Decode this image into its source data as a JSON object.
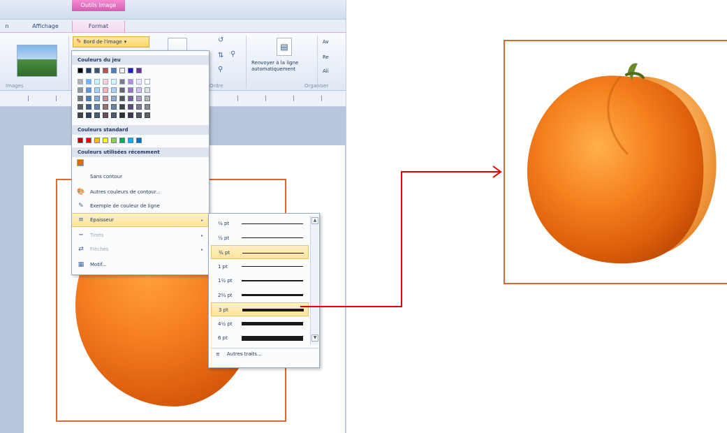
{
  "ribbon": {
    "context_group": "Outils Image",
    "tabs": [
      "Affichage",
      "Format"
    ],
    "border_button": "Bord de l'image",
    "wrap_label": "Renvoyer à la ligne automatiquement",
    "group_labels": [
      "Images",
      "Ordre",
      "Organiser"
    ],
    "organize_items": [
      "Av",
      "Re",
      "Ali"
    ]
  },
  "dropdown": {
    "theme_colors_heading": "Couleurs du jeu",
    "theme_colors": [
      "#000000",
      "#1f3864",
      "#44546a",
      "#c0504d",
      "#4f81bd",
      "#f2f2f2",
      "#1f1fbf",
      "#7030a0"
    ],
    "shade_columns": [
      "#7f7f7f",
      "#4f81bd",
      "#8db3e2",
      "#d99694",
      "#95b3d7",
      "#595959",
      "#8064a2",
      "#b2a1c7",
      "#bfbfbf"
    ],
    "standard_colors_heading": "Couleurs standard",
    "standard_colors": [
      "#c00000",
      "#ff0000",
      "#ffc000",
      "#ffff00",
      "#92d050",
      "#00b050",
      "#00b0f0",
      "#0070c0"
    ],
    "recent_colors_heading": "Couleurs utilisées récemment",
    "recent_colors": [
      "#e46c0a"
    ],
    "items": [
      {
        "label": "Sans contour"
      },
      {
        "label": "Autres couleurs de contour..."
      },
      {
        "label": "Exemple de couleur de ligne"
      },
      {
        "label": "Épaisseur"
      },
      {
        "label": "Tirets"
      },
      {
        "label": "Flèches"
      },
      {
        "label": "Motif..."
      }
    ]
  },
  "weight_submenu": {
    "weights": [
      {
        "label": "¼ pt",
        "pt": 0.25
      },
      {
        "label": "½ pt",
        "pt": 0.5
      },
      {
        "label": "¾ pt",
        "pt": 0.75
      },
      {
        "label": "1 pt",
        "pt": 1
      },
      {
        "label": "1½ pt",
        "pt": 1.5
      },
      {
        "label": "2¼ pt",
        "pt": 2.25
      },
      {
        "label": "3 pt",
        "pt": 3
      },
      {
        "label": "4½ pt",
        "pt": 4.5
      },
      {
        "label": "6 pt",
        "pt": 6
      }
    ],
    "highlighted": [
      "¾ pt",
      "3 pt"
    ],
    "more_label": "Autres traits..."
  },
  "colors": {
    "frame": "#d96a36",
    "arrow": "#e00000",
    "highlight": "#ffe39b"
  }
}
